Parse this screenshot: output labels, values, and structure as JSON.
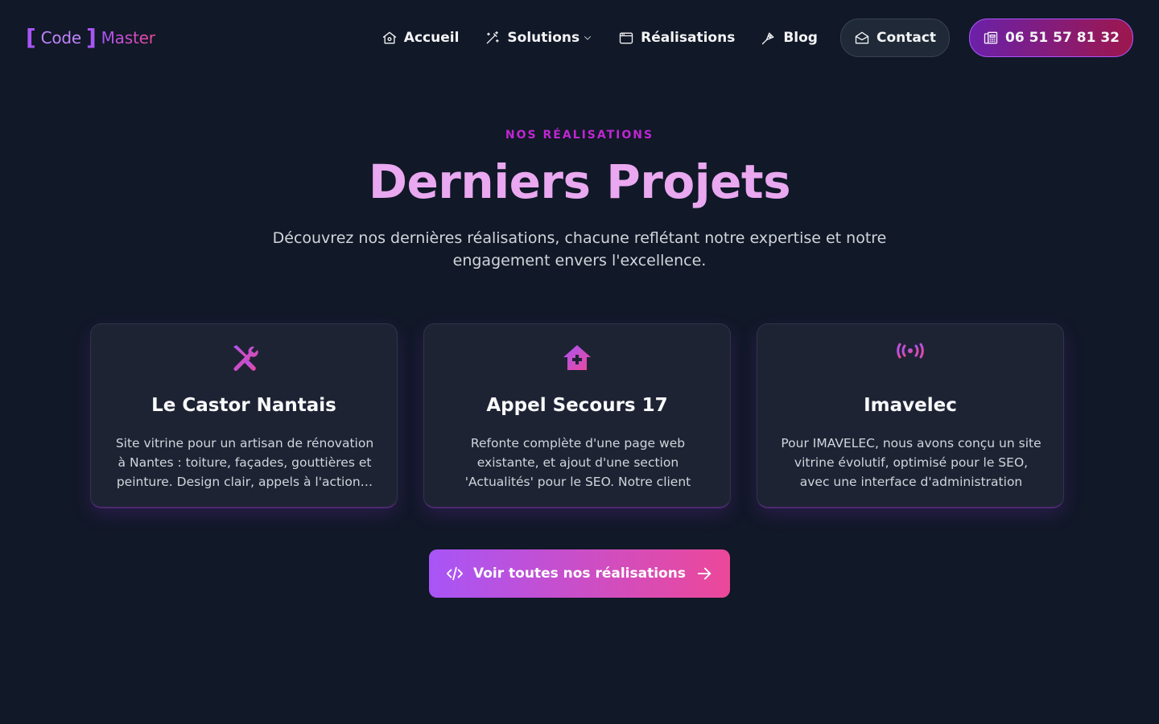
{
  "brand": {
    "bracket_open": "[",
    "word1": "Code",
    "bracket_close": "]",
    "word2": "Master"
  },
  "nav": {
    "items": [
      {
        "label": "Accueil",
        "icon": "home-icon"
      },
      {
        "label": "Solutions",
        "icon": "magic-wand-icon"
      },
      {
        "label": "Réalisations",
        "icon": "browser-window-icon"
      },
      {
        "label": "Blog",
        "icon": "pen-nib-icon"
      }
    ],
    "contact_label": "Contact",
    "phone_label": "06 51 57 81 32"
  },
  "hero": {
    "eyebrow": "NOS RÉALISATIONS",
    "title": "Derniers Projets",
    "subtitle": "Découvrez nos dernières réalisations, chacune reflétant notre expertise et notre engagement envers l'excellence."
  },
  "projects": [
    {
      "title": "Le Castor Nantais",
      "icon": "tools-icon",
      "description": "Site vitrine pour un artisan de rénovation à Nantes : toiture, façades, gouttières et peinture. Design clair, appels à l'action…"
    },
    {
      "title": "Appel Secours 17",
      "icon": "medical-house-icon",
      "description": "Refonte complète d'une page web existante, et ajout d'une section 'Actualités' pour le SEO. Notre client avais…"
    },
    {
      "title": "Imavelec",
      "icon": "antenna-icon",
      "description": "Pour IMAVELEC, nous avons conçu un site vitrine évolutif, optimisé pour le SEO, avec une interface d'administration intuitive. L…"
    }
  ],
  "cta": {
    "label": "Voir toutes nos réalisations"
  },
  "colors": {
    "background": "#111827",
    "accent_purple": "#a855f7",
    "accent_pink": "#ec4899",
    "title_pink": "#e9a8f0"
  }
}
